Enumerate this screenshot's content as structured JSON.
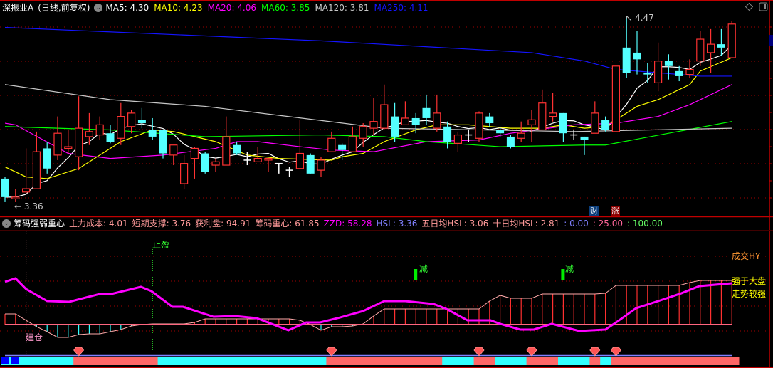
{
  "header": {
    "stock_name": "深振业A",
    "period": "(日线,前复权)",
    "ma": [
      {
        "label": "MA5: 4.30",
        "color": "#ffffff"
      },
      {
        "label": "MA10: 4.23",
        "color": "#ffff00"
      },
      {
        "label": "MA20: 4.06",
        "color": "#ff00ff"
      },
      {
        "label": "MA60: 3.85",
        "color": "#00ff00"
      },
      {
        "label": "MA120: 3.81",
        "color": "#c8c8c8"
      },
      {
        "label": "MA250: 4.11",
        "color": "#1414ff"
      }
    ]
  },
  "indicator": {
    "name": "筹码强弱重心",
    "items": [
      {
        "label": "主力成本: 4.01",
        "color": "#ff9a9a"
      },
      {
        "label": "短期支撑: 3.76",
        "color": "#ff9a9a"
      },
      {
        "label": "获利盘: 94.91",
        "color": "#ff9a9a"
      },
      {
        "label": "筹码重心: 61.85",
        "color": "#ff9a9a"
      },
      {
        "label": "ZZD: 58.28",
        "color": "#ff00ff"
      },
      {
        "label": "HSL: 3.36",
        "color": "#8080ff"
      },
      {
        "label": "五日均HSL: 3.06",
        "color": "#ff9a9a"
      },
      {
        "label": "十日均HSL: 2.81",
        "color": "#ff9a9a"
      },
      {
        "label": ": 0.00",
        "color": "#8080ff"
      },
      {
        "label": ": 25.00",
        "color": "#ff6699"
      },
      {
        "label": ": 100.00",
        "color": "#66ff66"
      }
    ],
    "signals": {
      "build": "建仓",
      "take_profit": "止盈",
      "reduce": "减",
      "volume": "成交HY",
      "stronger": "强于大盘",
      "trend": "走势较强"
    }
  },
  "badges": {
    "finance": "财",
    "rise": "涨"
  },
  "chart_data": {
    "type": "candlestick",
    "price_high_label": "4.47",
    "price_low_label": "3.36",
    "ylim": [
      3.36,
      4.47
    ],
    "colors": {
      "up": "#ff3232",
      "down": "#54ffff",
      "doji": "#ffffff"
    },
    "ohlc": [
      [
        3.5,
        3.51,
        3.36,
        3.39
      ],
      [
        3.38,
        3.44,
        3.36,
        3.39
      ],
      [
        3.42,
        3.68,
        3.41,
        3.44
      ],
      [
        3.44,
        3.78,
        3.44,
        3.66
      ],
      [
        3.68,
        3.72,
        3.53,
        3.56
      ],
      [
        3.64,
        3.87,
        3.61,
        3.77
      ],
      [
        3.68,
        3.79,
        3.65,
        3.69
      ],
      [
        3.63,
        3.99,
        3.55,
        3.8
      ],
      [
        3.75,
        3.89,
        3.7,
        3.78
      ],
      [
        3.76,
        3.87,
        3.73,
        3.82
      ],
      [
        3.77,
        3.82,
        3.71,
        3.72
      ],
      [
        3.74,
        3.95,
        3.7,
        3.87
      ],
      [
        3.81,
        3.91,
        3.77,
        3.89
      ],
      [
        3.85,
        3.92,
        3.8,
        3.83
      ],
      [
        3.79,
        3.86,
        3.73,
        3.75
      ],
      [
        3.79,
        3.79,
        3.62,
        3.65
      ],
      [
        3.64,
        3.7,
        3.58,
        3.7
      ],
      [
        3.47,
        3.64,
        3.44,
        3.59
      ],
      [
        3.62,
        3.69,
        3.5,
        3.68
      ],
      [
        3.65,
        3.66,
        3.53,
        3.54
      ],
      [
        3.58,
        3.62,
        3.54,
        3.6
      ],
      [
        3.58,
        3.87,
        3.58,
        3.75
      ],
      [
        3.7,
        3.72,
        3.64,
        3.65
      ],
      [
        3.61,
        3.66,
        3.58,
        3.61
      ],
      [
        3.6,
        3.69,
        3.6,
        3.62
      ],
      [
        3.61,
        3.62,
        3.54,
        3.62
      ],
      [
        3.59,
        3.59,
        3.53,
        3.59
      ],
      [
        3.55,
        3.57,
        3.51,
        3.55
      ],
      [
        3.56,
        3.85,
        3.56,
        3.65
      ],
      [
        3.64,
        3.65,
        3.53,
        3.53
      ],
      [
        3.55,
        3.63,
        3.51,
        3.61
      ],
      [
        3.66,
        3.78,
        3.66,
        3.74
      ],
      [
        3.7,
        3.71,
        3.61,
        3.67
      ],
      [
        3.66,
        3.81,
        3.66,
        3.75
      ],
      [
        3.74,
        3.83,
        3.69,
        3.81
      ],
      [
        3.8,
        3.98,
        3.76,
        3.84
      ],
      [
        3.8,
        4.06,
        3.8,
        3.94
      ],
      [
        3.87,
        3.95,
        3.72,
        3.75
      ],
      [
        3.82,
        3.96,
        3.82,
        3.86
      ],
      [
        3.86,
        3.89,
        3.77,
        3.82
      ],
      [
        3.92,
        4.0,
        3.82,
        3.86
      ],
      [
        3.8,
        4.0,
        3.78,
        3.89
      ],
      [
        3.81,
        3.84,
        3.68,
        3.72
      ],
      [
        3.71,
        3.78,
        3.66,
        3.76
      ],
      [
        3.76,
        3.79,
        3.72,
        3.76
      ],
      [
        3.74,
        3.9,
        3.72,
        3.89
      ],
      [
        3.87,
        3.89,
        3.81,
        3.83
      ],
      [
        3.79,
        3.81,
        3.75,
        3.77
      ],
      [
        3.75,
        3.76,
        3.68,
        3.69
      ],
      [
        3.74,
        3.84,
        3.72,
        3.77
      ],
      [
        3.82,
        3.91,
        3.72,
        3.85
      ],
      [
        3.79,
        4.03,
        3.79,
        3.95
      ],
      [
        3.87,
        4.01,
        3.84,
        3.89
      ],
      [
        3.89,
        3.89,
        3.72,
        3.77
      ],
      [
        3.76,
        3.79,
        3.73,
        3.76
      ],
      [
        3.75,
        3.75,
        3.64,
        3.73
      ],
      [
        3.77,
        3.96,
        3.77,
        3.89
      ],
      [
        3.85,
        3.87,
        3.78,
        3.79
      ],
      [
        3.78,
        4.17,
        3.78,
        4.17
      ],
      [
        4.28,
        4.47,
        4.1,
        4.13
      ],
      [
        4.25,
        4.38,
        4.12,
        4.21
      ],
      [
        4.13,
        4.19,
        4.07,
        4.12
      ],
      [
        4.07,
        4.31,
        4.02,
        4.2
      ],
      [
        4.2,
        4.24,
        4.09,
        4.17
      ],
      [
        4.14,
        4.17,
        4.08,
        4.11
      ],
      [
        4.12,
        4.21,
        4.1,
        4.15
      ],
      [
        4.2,
        4.38,
        4.17,
        4.33
      ],
      [
        4.25,
        4.39,
        4.13,
        4.3
      ],
      [
        4.3,
        4.39,
        4.23,
        4.28
      ],
      [
        4.22,
        4.44,
        4.22,
        4.42
      ]
    ],
    "ma_lines": [
      {
        "name": "MA5",
        "color": "#ffffff",
        "period": 5
      },
      {
        "name": "MA10",
        "color": "#ffff00",
        "points": [
          [
            0,
            3.57
          ],
          [
            2,
            3.51
          ],
          [
            4,
            3.5
          ],
          [
            7,
            3.56
          ],
          [
            9,
            3.64
          ],
          [
            11,
            3.72
          ],
          [
            14,
            3.79
          ],
          [
            16,
            3.78
          ],
          [
            20,
            3.72
          ],
          [
            23,
            3.64
          ],
          [
            26,
            3.62
          ],
          [
            31,
            3.61
          ],
          [
            32,
            3.63
          ],
          [
            34,
            3.65
          ],
          [
            36,
            3.72
          ],
          [
            39,
            3.79
          ],
          [
            41,
            3.82
          ],
          [
            44,
            3.82
          ],
          [
            48,
            3.8
          ],
          [
            51,
            3.8
          ],
          [
            53,
            3.82
          ],
          [
            55,
            3.8
          ],
          [
            57,
            3.81
          ],
          [
            59,
            3.89
          ],
          [
            60,
            3.93
          ],
          [
            62,
            3.97
          ],
          [
            65,
            4.06
          ],
          [
            66,
            4.14
          ],
          [
            69,
            4.22
          ]
        ]
      },
      {
        "name": "MA20",
        "color": "#ff00ff",
        "points": [
          [
            0,
            3.83
          ],
          [
            1,
            3.82
          ],
          [
            6,
            3.65
          ],
          [
            10,
            3.62
          ],
          [
            15,
            3.64
          ],
          [
            20,
            3.68
          ],
          [
            22,
            3.72
          ],
          [
            24,
            3.72
          ],
          [
            28,
            3.69
          ],
          [
            31,
            3.67
          ],
          [
            35,
            3.66
          ],
          [
            40,
            3.72
          ],
          [
            45,
            3.73
          ],
          [
            48,
            3.77
          ],
          [
            54,
            3.82
          ],
          [
            58,
            3.83
          ],
          [
            62,
            3.87
          ],
          [
            65,
            3.94
          ],
          [
            69,
            4.06
          ]
        ]
      },
      {
        "name": "MA60",
        "color": "#00ff00",
        "points": [
          [
            0,
            3.81
          ],
          [
            10,
            3.79
          ],
          [
            19,
            3.75
          ],
          [
            30,
            3.76
          ],
          [
            36,
            3.75
          ],
          [
            40,
            3.72
          ],
          [
            47,
            3.69
          ],
          [
            55,
            3.7
          ],
          [
            57,
            3.7
          ],
          [
            63,
            3.77
          ],
          [
            69,
            3.84
          ]
        ]
      },
      {
        "name": "MA120",
        "color": "#c8c8c8",
        "points": [
          [
            0,
            4.06
          ],
          [
            10,
            3.97
          ],
          [
            19,
            3.93
          ],
          [
            36,
            3.8
          ],
          [
            54,
            3.78
          ],
          [
            69,
            3.8
          ]
        ]
      },
      {
        "name": "MA250",
        "color": "#1414ff",
        "points": [
          [
            0,
            4.4
          ],
          [
            30,
            4.32
          ],
          [
            50,
            4.25
          ],
          [
            55,
            4.2
          ],
          [
            58,
            4.15
          ],
          [
            66,
            4.11
          ],
          [
            69,
            4.11
          ]
        ]
      }
    ],
    "sub": {
      "baseline": 9.5,
      "main_force": [
        23.8,
        23.8,
        15.2,
        6.7,
        0,
        -7.6,
        -7.6,
        -3.8,
        -2.9,
        -2.9,
        0,
        2.9,
        7.6,
        9.5,
        10.5,
        10.5,
        10.5,
        10.5,
        12.4,
        17.1,
        17.1,
        17.1,
        17.1,
        17.1,
        17.1,
        17.1,
        17.1,
        17.1,
        15.2,
        9.5,
        1.9,
        6.7,
        6.7,
        7.6,
        10.5,
        21.0,
        30.5,
        30.5,
        30.5,
        30.5,
        30.5,
        30.5,
        30.5,
        30.5,
        30.5,
        30.5,
        41.0,
        48.6,
        44.8,
        44.8,
        44.8,
        50.5,
        50.5,
        50.5,
        50.5,
        50.5,
        50.5,
        51.4,
        61.9,
        61.9,
        61.9,
        61.9,
        61.9,
        61.9,
        61.9,
        65.7,
        68.6,
        68.6,
        68.6,
        68.6
      ],
      "zzd": [
        [
          0,
          66.7
        ],
        [
          1,
          71.4
        ],
        [
          2,
          57.1
        ],
        [
          4,
          41.0
        ],
        [
          6.1,
          40.0
        ],
        [
          9,
          50.5
        ],
        [
          10.1,
          50.5
        ],
        [
          12.9,
          60.0
        ],
        [
          13.9,
          54.3
        ],
        [
          15.9,
          33.3
        ],
        [
          16.9,
          33.3
        ],
        [
          19.8,
          20.0
        ],
        [
          21.8,
          21.0
        ],
        [
          23.9,
          18.1
        ],
        [
          26.9,
          1.9
        ],
        [
          28.6,
          12.4
        ],
        [
          29.9,
          12.4
        ],
        [
          31.8,
          19.0
        ],
        [
          34,
          27.6
        ],
        [
          36,
          41.0
        ],
        [
          38,
          41.0
        ],
        [
          40.7,
          37.1
        ],
        [
          41.9,
          30.5
        ],
        [
          43.9,
          15.2
        ],
        [
          46.1,
          15.2
        ],
        [
          47,
          10.5
        ],
        [
          48.9,
          2.9
        ],
        [
          50.2,
          2.9
        ],
        [
          51.9,
          10.5
        ],
        [
          54.5,
          1.0
        ],
        [
          57,
          2.9
        ],
        [
          58.1,
          13.3
        ],
        [
          59.9,
          31.4
        ],
        [
          62.2,
          41.9
        ],
        [
          64.2,
          51.4
        ],
        [
          65.9,
          61.0
        ],
        [
          69,
          64.8
        ]
      ],
      "state_bar": [
        "c",
        "c",
        "c",
        "c",
        "c",
        "c",
        "c",
        "r",
        "r",
        "r",
        "r",
        "r",
        "r",
        "r",
        "r",
        "c",
        "c",
        "c",
        "c",
        "c",
        "c",
        "c",
        "c",
        "c",
        "c",
        "c",
        "c",
        "c",
        "c",
        "c",
        "c",
        "r",
        "r",
        "r",
        "r",
        "r",
        "r",
        "r",
        "r",
        "r",
        "r",
        "r",
        "c",
        "c",
        "c",
        "r",
        "r",
        "c",
        "c",
        "c",
        "r",
        "r",
        "r",
        "c",
        "c",
        "c",
        "r",
        "c",
        "r",
        "r",
        "r",
        "r",
        "r",
        "r",
        "r",
        "r",
        "r",
        "r",
        "r",
        "r"
      ],
      "state_colors": {
        "c": "#33ffff",
        "r": "#ff6666"
      },
      "gem_signals": [
        7,
        31,
        45,
        50,
        56,
        58
      ],
      "build_index": 2,
      "take_profit_index": 14,
      "reduce_indices": [
        39,
        53
      ]
    },
    "badge_indices": {
      "finance": 56,
      "rise": 58
    }
  }
}
